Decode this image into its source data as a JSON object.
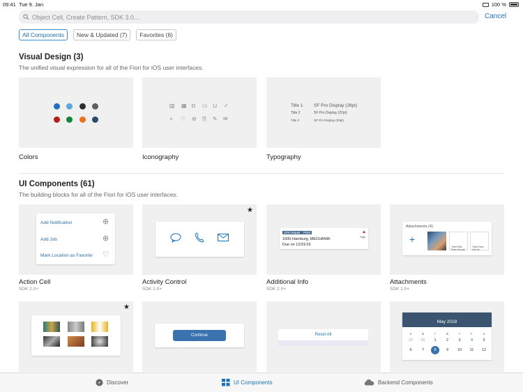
{
  "status_bar": {
    "time": "09:41",
    "date": "Tue 9. Jan",
    "battery": "100 %"
  },
  "search": {
    "placeholder": "Object Cell, Create Pattern, SDK 3.0...",
    "cancel_label": "Cancel"
  },
  "filters": [
    {
      "label": "All Components",
      "active": true
    },
    {
      "label": "New & Updated (7)",
      "active": false
    },
    {
      "label": "Favorites (6)",
      "active": false
    }
  ],
  "visual_design": {
    "title": "Visual Design (3)",
    "subtitle": "The unified visual expression for all of the Fiori for iOS user interfaces.",
    "cards": [
      {
        "label": "Colors"
      },
      {
        "label": "Iconography"
      },
      {
        "label": "Typography"
      }
    ],
    "colors": [
      "#1f6fc2",
      "#5aa6df",
      "#2d2d2d",
      "#5e5e5e",
      "#bb1a1a",
      "#12843b",
      "#e8731f",
      "#2f4a66"
    ],
    "typography": [
      {
        "name": "Title 1",
        "font": "SF Pro Display (28pt)"
      },
      {
        "name": "Title 2",
        "font": "SF Pro Display (22pt)"
      },
      {
        "name": "Title 3",
        "font": "SF Pro Display (20pt)"
      }
    ]
  },
  "ui_components": {
    "title": "UI Components (61)",
    "subtitle": "The building blocks for all of the Fiori for iOS user interfaces.",
    "cards": [
      {
        "label": "Action Cell",
        "sdk": "SDK 2.0+"
      },
      {
        "label": "Activity Control",
        "sdk": "SDK 1.0+"
      },
      {
        "label": "Additional Info",
        "sdk": "SDK 2.0+"
      },
      {
        "label": "Attachments",
        "sdk": "SDK 1.0+"
      }
    ],
    "action_cell": {
      "rows": [
        "Add Notification",
        "Add Job",
        "Mark Location as Favorite"
      ]
    },
    "additional_info": {
      "tags": [
        "10% Repair",
        "PDM"
      ],
      "line1": "1000-Hamburg, MECHANIK",
      "line2": "Due on 12/31/16",
      "priority": "High"
    },
    "attachments": {
      "title": "Attachments (4)",
      "files": [
        "Team Mkt. Plan info.pdf",
        "Team New Info.txt"
      ]
    },
    "continue_label": "Continue",
    "reset_label": "Reset All",
    "calendar": {
      "month": "May 2018",
      "weekdays": [
        "S",
        "M",
        "T",
        "W",
        "T",
        "F",
        "S"
      ],
      "week1": [
        "29",
        "30",
        "1",
        "2",
        "3",
        "4",
        "5"
      ],
      "week2": [
        "6",
        "7",
        "8",
        "9",
        "10",
        "11",
        "12"
      ]
    }
  },
  "tabs": [
    {
      "label": "Discover",
      "icon": "compass-icon"
    },
    {
      "label": "UI Components",
      "icon": "grid-icon",
      "active": true
    },
    {
      "label": "Backend Components",
      "icon": "cloud-icon"
    }
  ]
}
